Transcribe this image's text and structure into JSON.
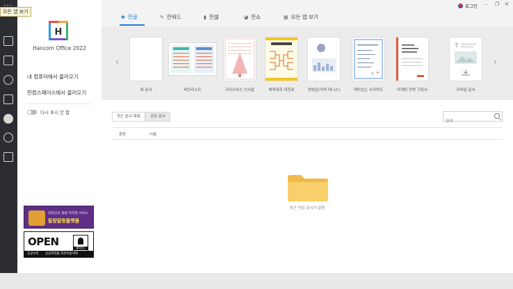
{
  "rail": {
    "dots": "•••",
    "tooltip": "모든 앱 보기"
  },
  "left_panel": {
    "product_name": "Hancom Office 2022",
    "open_from_computer": "내 컴퓨터에서 불러오기",
    "open_from_space": "한컴스페이스에서 불러오기",
    "dont_show_again": "다시 표시 안 함",
    "banner1_line1": "대한민국 생활 저작권 서비스",
    "banner1_line2": "말랑말랑플랫폼",
    "banner2_open": "OPEN",
    "banner2_badge": "출처표시",
    "banner2_foot_left": "공공누리",
    "banner2_foot_right": "공공저작물 자유이용허락"
  },
  "top_tabs": [
    {
      "label": "한글",
      "icon": "hangul-icon",
      "glyph": "✱"
    },
    {
      "label": "한워드",
      "icon": "pen-icon",
      "glyph": "✎"
    },
    {
      "label": "한셀",
      "icon": "bar-chart-icon",
      "glyph": "▮"
    },
    {
      "label": "한쇼",
      "icon": "pie-icon",
      "glyph": "◕"
    },
    {
      "label": "모든 앱 보기",
      "icon": "grid-icon",
      "glyph": "▦"
    }
  ],
  "login": "로그인",
  "templates": [
    {
      "label": "새 문서"
    },
    {
      "label": "버킷리스트"
    },
    {
      "label": "크리스마스 인사말"
    },
    {
      "label": "체육대회 대진표"
    },
    {
      "label": "연애운(커피 테니스)"
    },
    {
      "label": "재미있는 수리퀴즈"
    },
    {
      "label": "마케팅 전략 기획서"
    },
    {
      "label": "모바일 문서"
    }
  ],
  "doc_tabs": {
    "recent": "최근 문서 목록",
    "shared": "공유 문서"
  },
  "search": {
    "placeholder": "검색"
  },
  "columns": {
    "type": "종류",
    "name": "이름"
  },
  "empty_message": "최근 작업 문서가 없음"
}
